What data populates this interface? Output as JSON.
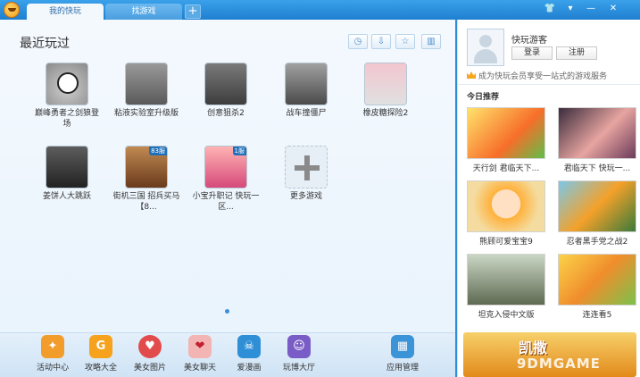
{
  "tabs": [
    {
      "label": "我的快玩"
    },
    {
      "label": "找游戏"
    }
  ],
  "tab_add": "+",
  "window_controls": {
    "skin": "👕",
    "menu": "▾",
    "minimize": "—",
    "close": "✕"
  },
  "main": {
    "section_title": "最近玩过",
    "toolbar_icons": [
      "clock-icon",
      "download-icon",
      "star-icon",
      "trash-icon"
    ],
    "games": [
      {
        "label": "巅峰勇者之剑狼登场",
        "badge": ""
      },
      {
        "label": "粘液实验室升级版",
        "badge": ""
      },
      {
        "label": "创意狙杀2",
        "badge": ""
      },
      {
        "label": "战车撞僵尸",
        "badge": ""
      },
      {
        "label": "橡皮糖探险2",
        "badge": ""
      },
      {
        "label": "姜饼人大跳跃",
        "badge": ""
      },
      {
        "label": "街机三国 招兵买马 【8...",
        "badge": "83服"
      },
      {
        "label": "小宝升职记 快玩一区...",
        "badge": "1服"
      },
      {
        "label": "更多游戏",
        "badge": ""
      }
    ]
  },
  "dock": [
    {
      "label": "活动中心",
      "icon": "gift-icon",
      "color": "#f29d2b",
      "glyph": "✦"
    },
    {
      "label": "攻略大全",
      "icon": "guide-icon",
      "color": "#f7a21c",
      "glyph": "G"
    },
    {
      "label": "美女图片",
      "icon": "heart-icon",
      "color": "#e14b4b",
      "glyph": "♥"
    },
    {
      "label": "美女聊天",
      "icon": "lips-icon",
      "color": "#f3b4b4",
      "glyph": "❤"
    },
    {
      "label": "爱漫画",
      "icon": "skull-icon",
      "color": "#2f8fd6",
      "glyph": "☠"
    },
    {
      "label": "玩博大厅",
      "icon": "chat-icon",
      "color": "#7a5cc7",
      "glyph": "☺"
    },
    {
      "label": "应用管理",
      "icon": "apps-grid-icon",
      "color": "#3b93d8",
      "glyph": "▦"
    }
  ],
  "sidebar": {
    "username": "快玩游客",
    "login_label": "登录",
    "register_label": "注册",
    "promo_text": "成为快玩会员享受一站式的游戏服务",
    "recommend_title": "今日推荐",
    "recommendations": [
      {
        "label": "天行剑 君临天下..."
      },
      {
        "label": "君临天下 快玩一..."
      },
      {
        "label": "熊顾可爱宝宝9"
      },
      {
        "label": "忍者黑手党之战2"
      },
      {
        "label": "坦克入侵中文版"
      },
      {
        "label": "连连看5"
      }
    ],
    "banner_text": "凯撒",
    "watermark": "9DMGAME"
  }
}
